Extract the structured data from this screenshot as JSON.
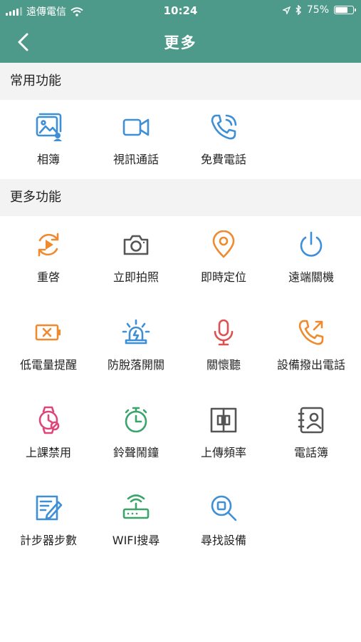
{
  "status": {
    "carrier": "遠傳電信",
    "time": "10:24",
    "battery": "75%",
    "battery_level": 0.75
  },
  "nav": {
    "title": "更多",
    "back_icon": "chevron-left-icon"
  },
  "sections": {
    "common": {
      "title": "常用功能",
      "items": [
        {
          "label": "相簿",
          "icon": "photo-album-icon",
          "color": "#3f8fd6"
        },
        {
          "label": "視訊通話",
          "icon": "video-camera-icon",
          "color": "#3f8fd6"
        },
        {
          "label": "免費電話",
          "icon": "phone-call-icon",
          "color": "#3f8fd6"
        }
      ]
    },
    "more": {
      "title": "更多功能",
      "items": [
        {
          "label": "重啓",
          "icon": "restart-icon",
          "color": "#ef8a2e"
        },
        {
          "label": "立即拍照",
          "icon": "camera-icon",
          "color": "#555555"
        },
        {
          "label": "即時定位",
          "icon": "location-pin-icon",
          "color": "#ef8a2e"
        },
        {
          "label": "遠端關機",
          "icon": "power-icon",
          "color": "#3f8fd6"
        },
        {
          "label": "低電量提醒",
          "icon": "low-battery-icon",
          "color": "#ef8a2e"
        },
        {
          "label": "防脫落開關",
          "icon": "alarm-light-icon",
          "color": "#3f8fd6"
        },
        {
          "label": "關懷聽",
          "icon": "microphone-icon",
          "color": "#e05050"
        },
        {
          "label": "設備撥出電話",
          "icon": "outgoing-call-icon",
          "color": "#ef8a2e"
        },
        {
          "label": "上課禁用",
          "icon": "watch-disabled-icon",
          "color": "#e0457a"
        },
        {
          "label": "鈴聲鬧鐘",
          "icon": "alarm-clock-icon",
          "color": "#3aa46b"
        },
        {
          "label": "上傳頻率",
          "icon": "upload-frequency-icon",
          "color": "#555555"
        },
        {
          "label": "電話簿",
          "icon": "phonebook-icon",
          "color": "#555555"
        },
        {
          "label": "計步器步數",
          "icon": "pedometer-icon",
          "color": "#3f8fd6"
        },
        {
          "label": "WIFI搜尋",
          "icon": "wifi-router-icon",
          "color": "#3aa46b"
        },
        {
          "label": "尋找設備",
          "icon": "search-device-icon",
          "color": "#3f8fd6"
        }
      ]
    }
  }
}
